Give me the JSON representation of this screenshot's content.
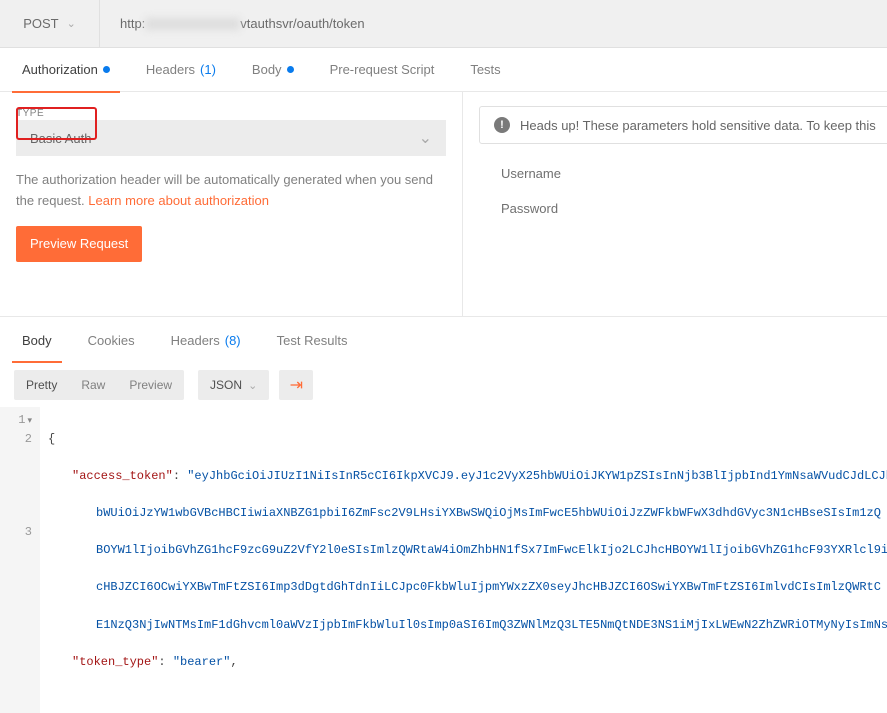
{
  "request": {
    "method": "POST",
    "url_prefix": "http:",
    "url_suffix": "vtauthsvr/oauth/token"
  },
  "tabs": {
    "authorization": {
      "label": "Authorization",
      "has_dot": true
    },
    "headers": {
      "label": "Headers",
      "count": "(1)"
    },
    "body": {
      "label": "Body",
      "has_dot": true
    },
    "prerequest": {
      "label": "Pre-request Script"
    },
    "tests": {
      "label": "Tests"
    }
  },
  "auth_panel": {
    "type_label": "TYPE",
    "selected_type": "Basic Auth",
    "help_text": "The authorization header will be automatically generated when you send the request. ",
    "help_link": "Learn more about authorization",
    "preview_button": "Preview Request"
  },
  "right_panel": {
    "alert_text": "Heads up! These parameters hold sensitive data. To keep this ",
    "username_label": "Username",
    "password_label": "Password"
  },
  "response_tabs": {
    "body": "Body",
    "cookies": "Cookies",
    "headers": {
      "label": "Headers",
      "count": "(8)"
    },
    "test_results": "Test Results"
  },
  "viewer": {
    "pretty": "Pretty",
    "raw": "Raw",
    "preview": "Preview",
    "format": "JSON"
  },
  "response_body": {
    "line1": "{",
    "line2_key": "\"access_token\"",
    "line2_val_a": "\"eyJhbGciOiJIUzI1NiIsInR5cCI6IkpXVCJ9.eyJ1c2VyX25hbWUiOiJKYW1pZSIsInNjb3BlIjpbInd1YmNsaWVudCJdLCJh",
    "line2_val_b": "bWUiOiJzYW1wbGVBcHBCIiwiaXNBZG1pbiI6ZmFsc2V9LHsiYXBwSWQiOjMsImFwcE5hbWUiOiJzZWFkbWFwX3dhdGVyc3N1cHBseSIsIm1zQ",
    "line2_val_c": "BOYW1lIjoibGVhZG1hcF9zcG9uZ2VfY2l0eSIsImlzQWRtaW4iOmZhbHN1fSx7ImFwcElkIjo2LCJhcHBOYW1lIjoibGVhZG1hcF93YXRlcl9i",
    "line2_val_d": "cHBJZCI6OCwiYXBwTmFtZSI6Imp3dDgtdGhTdnIiLCJpc0FkbWluIjpmYWxzZX0seyJhcHBJZCI6OSwiYXBwTmFtZSI6ImlvdCIsImlzQWRtC",
    "line2_val_e": "E1NzQ3NjIwNTMsImF1dGhvcml0aWVzIjpbImFkbWluIl0sImp0aSI6ImQ3ZWNlMzQ3LTE5NmQtNDE3NS1iMjIxLWEwN2ZhZWRiOTMyNyIsImNs",
    "line3_key": "\"token_type\"",
    "line3_val": "\"bearer\""
  }
}
